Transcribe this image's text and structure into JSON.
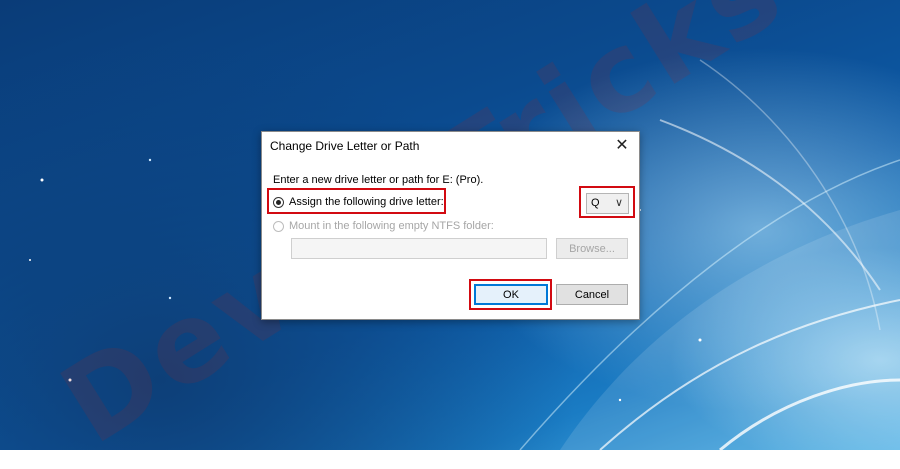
{
  "dialog": {
    "title": "Change Drive Letter or Path",
    "close_glyph": "✕",
    "prompt": "Enter a new drive letter or path for E: (Pro).",
    "option_assign": "Assign the following drive letter:",
    "option_mount": "Mount in the following empty NTFS folder:",
    "drive_letter_value": "Q",
    "chevron_glyph": "∨",
    "browse_label": "Browse...",
    "ok_label": "OK",
    "cancel_label": "Cancel"
  },
  "watermark": "DeviceTricks",
  "colors": {
    "highlight": "#d20a11",
    "accent": "#0078d7"
  }
}
